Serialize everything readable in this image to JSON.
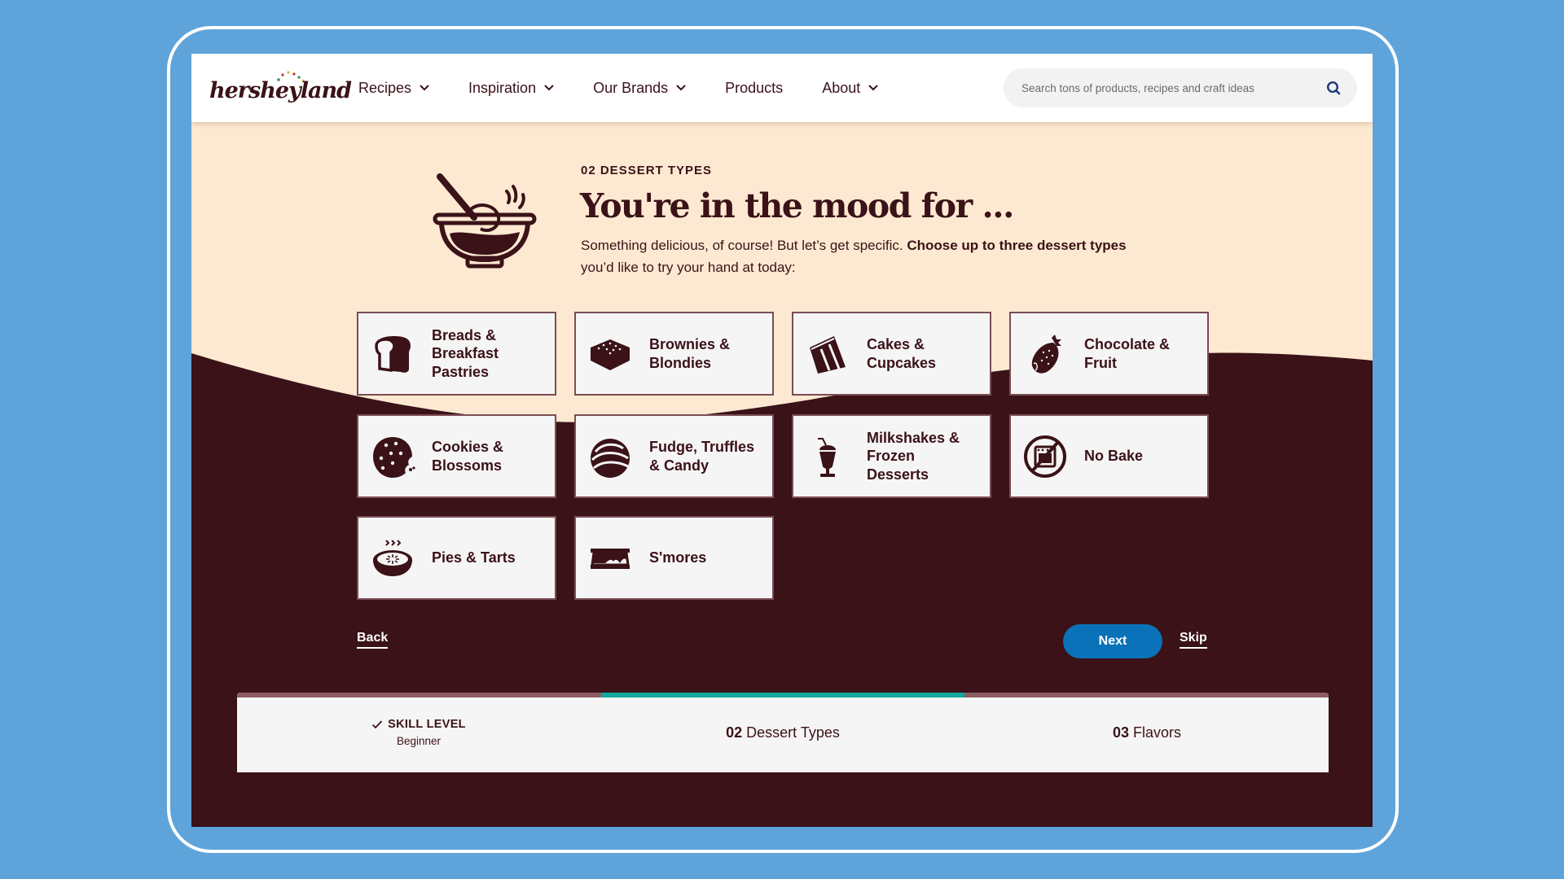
{
  "header": {
    "logo_text": "hersheyland",
    "nav": [
      {
        "label": "Recipes",
        "has_dropdown": true
      },
      {
        "label": "Inspiration",
        "has_dropdown": true
      },
      {
        "label": "Our Brands",
        "has_dropdown": true
      },
      {
        "label": "Products",
        "has_dropdown": false
      },
      {
        "label": "About",
        "has_dropdown": true
      }
    ],
    "search": {
      "placeholder": "Search tons of products, recipes and craft ideas",
      "value": "",
      "icon": "search-icon"
    }
  },
  "intro": {
    "icon": "mixing-bowl-icon",
    "eyebrow": "02 DESSERT TYPES",
    "title": "You're in the mood for ...",
    "desc_plain_1": "Something delicious, of course! But let’s get specific. ",
    "desc_bold": "Choose up to three dessert types",
    "desc_plain_2": " you’d like to try your hand at today:"
  },
  "dessert_types": [
    {
      "label": "Breads &\nBreakfast\nPastries",
      "icon": "bread-icon",
      "selected": false
    },
    {
      "label": "Brownies &\nBlondies",
      "icon": "brownie-icon",
      "selected": false
    },
    {
      "label": "Cakes &\nCupcakes",
      "icon": "cake-slice-icon",
      "selected": false
    },
    {
      "label": "Chocolate &\nFruit",
      "icon": "chocolate-strawberry-icon",
      "selected": false
    },
    {
      "label": "Cookies &\nBlossoms",
      "icon": "cookie-icon",
      "selected": false
    },
    {
      "label": "Fudge, Truffles\n& Candy",
      "icon": "truffle-icon",
      "selected": false
    },
    {
      "label": "Milkshakes &\nFrozen\nDesserts",
      "icon": "milkshake-icon",
      "selected": false
    },
    {
      "label": "No Bake",
      "icon": "no-oven-icon",
      "selected": false
    },
    {
      "label": "Pies & Tarts",
      "icon": "pie-icon",
      "selected": false
    },
    {
      "label": "S'mores",
      "icon": "smores-icon",
      "selected": false
    }
  ],
  "actions": {
    "back_label": "Back",
    "next_label": "Next",
    "skip_label": "Skip"
  },
  "progress": {
    "current_step": 2,
    "total_steps": 3,
    "steps": [
      {
        "number": "",
        "title": "SKILL LEVEL",
        "value": "Beginner",
        "completed": true
      },
      {
        "number": "02",
        "title": "Dessert Types",
        "completed": false,
        "active": true
      },
      {
        "number": "03",
        "title": "Flavors",
        "completed": false,
        "active": false
      }
    ]
  },
  "colors": {
    "brand_dark": "#3a1218",
    "cream": "#fde9d1",
    "accent_blue": "#0a72b8",
    "progress_teal": "#13a89e",
    "progress_track": "#8c5d64",
    "page_bg": "#5ea4db"
  }
}
